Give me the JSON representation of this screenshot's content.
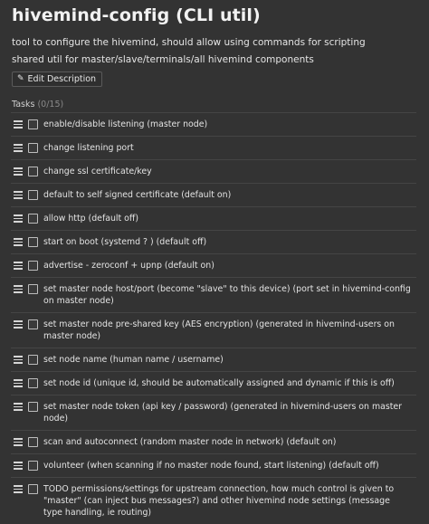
{
  "header": {
    "title": "hivemind-config (CLI util)",
    "description_lines": [
      "tool to configure the hivemind, should allow using commands for scripting",
      "shared util for master/slave/terminals/all hivemind components"
    ],
    "edit_label": "Edit Description"
  },
  "tasks": {
    "heading": "Tasks",
    "count": "(0/15)",
    "items": [
      {
        "label": "enable/disable listening (master node)"
      },
      {
        "label": "change listening port"
      },
      {
        "label": "change ssl certificate/key"
      },
      {
        "label": "default to self signed certificate (default on)"
      },
      {
        "label": "allow http (default off)"
      },
      {
        "label": "start on boot (systemd ? ) (default off)"
      },
      {
        "label": "advertise - zeroconf + upnp (default on)"
      },
      {
        "label": "set master node host/port (become \"slave\" to this device) (port set in hivemind-config on master node)"
      },
      {
        "label": "set master node pre-shared key (AES encryption) (generated in hivemind-users on master node)"
      },
      {
        "label": "set node name (human name / username)"
      },
      {
        "label": "set node id (unique id, should be automatically assigned and dynamic if this is off)"
      },
      {
        "label": "set master node token (api key / password) (generated in hivemind-users on master node)"
      },
      {
        "label": "scan and autoconnect (random master node in network) (default on)"
      },
      {
        "label": "volunteer (when scanning if no master node found, start listening) (default off)"
      },
      {
        "label": "TODO permissions/settings for upstream connection, how much control is given to \"master\" (can inject bus messages?) and other hivemind node settings (message type handling, ie routing)"
      }
    ]
  },
  "icons": {
    "edit": "pencil-icon",
    "drag": "drag-handle-icon",
    "checkbox": "checkbox-unchecked"
  }
}
